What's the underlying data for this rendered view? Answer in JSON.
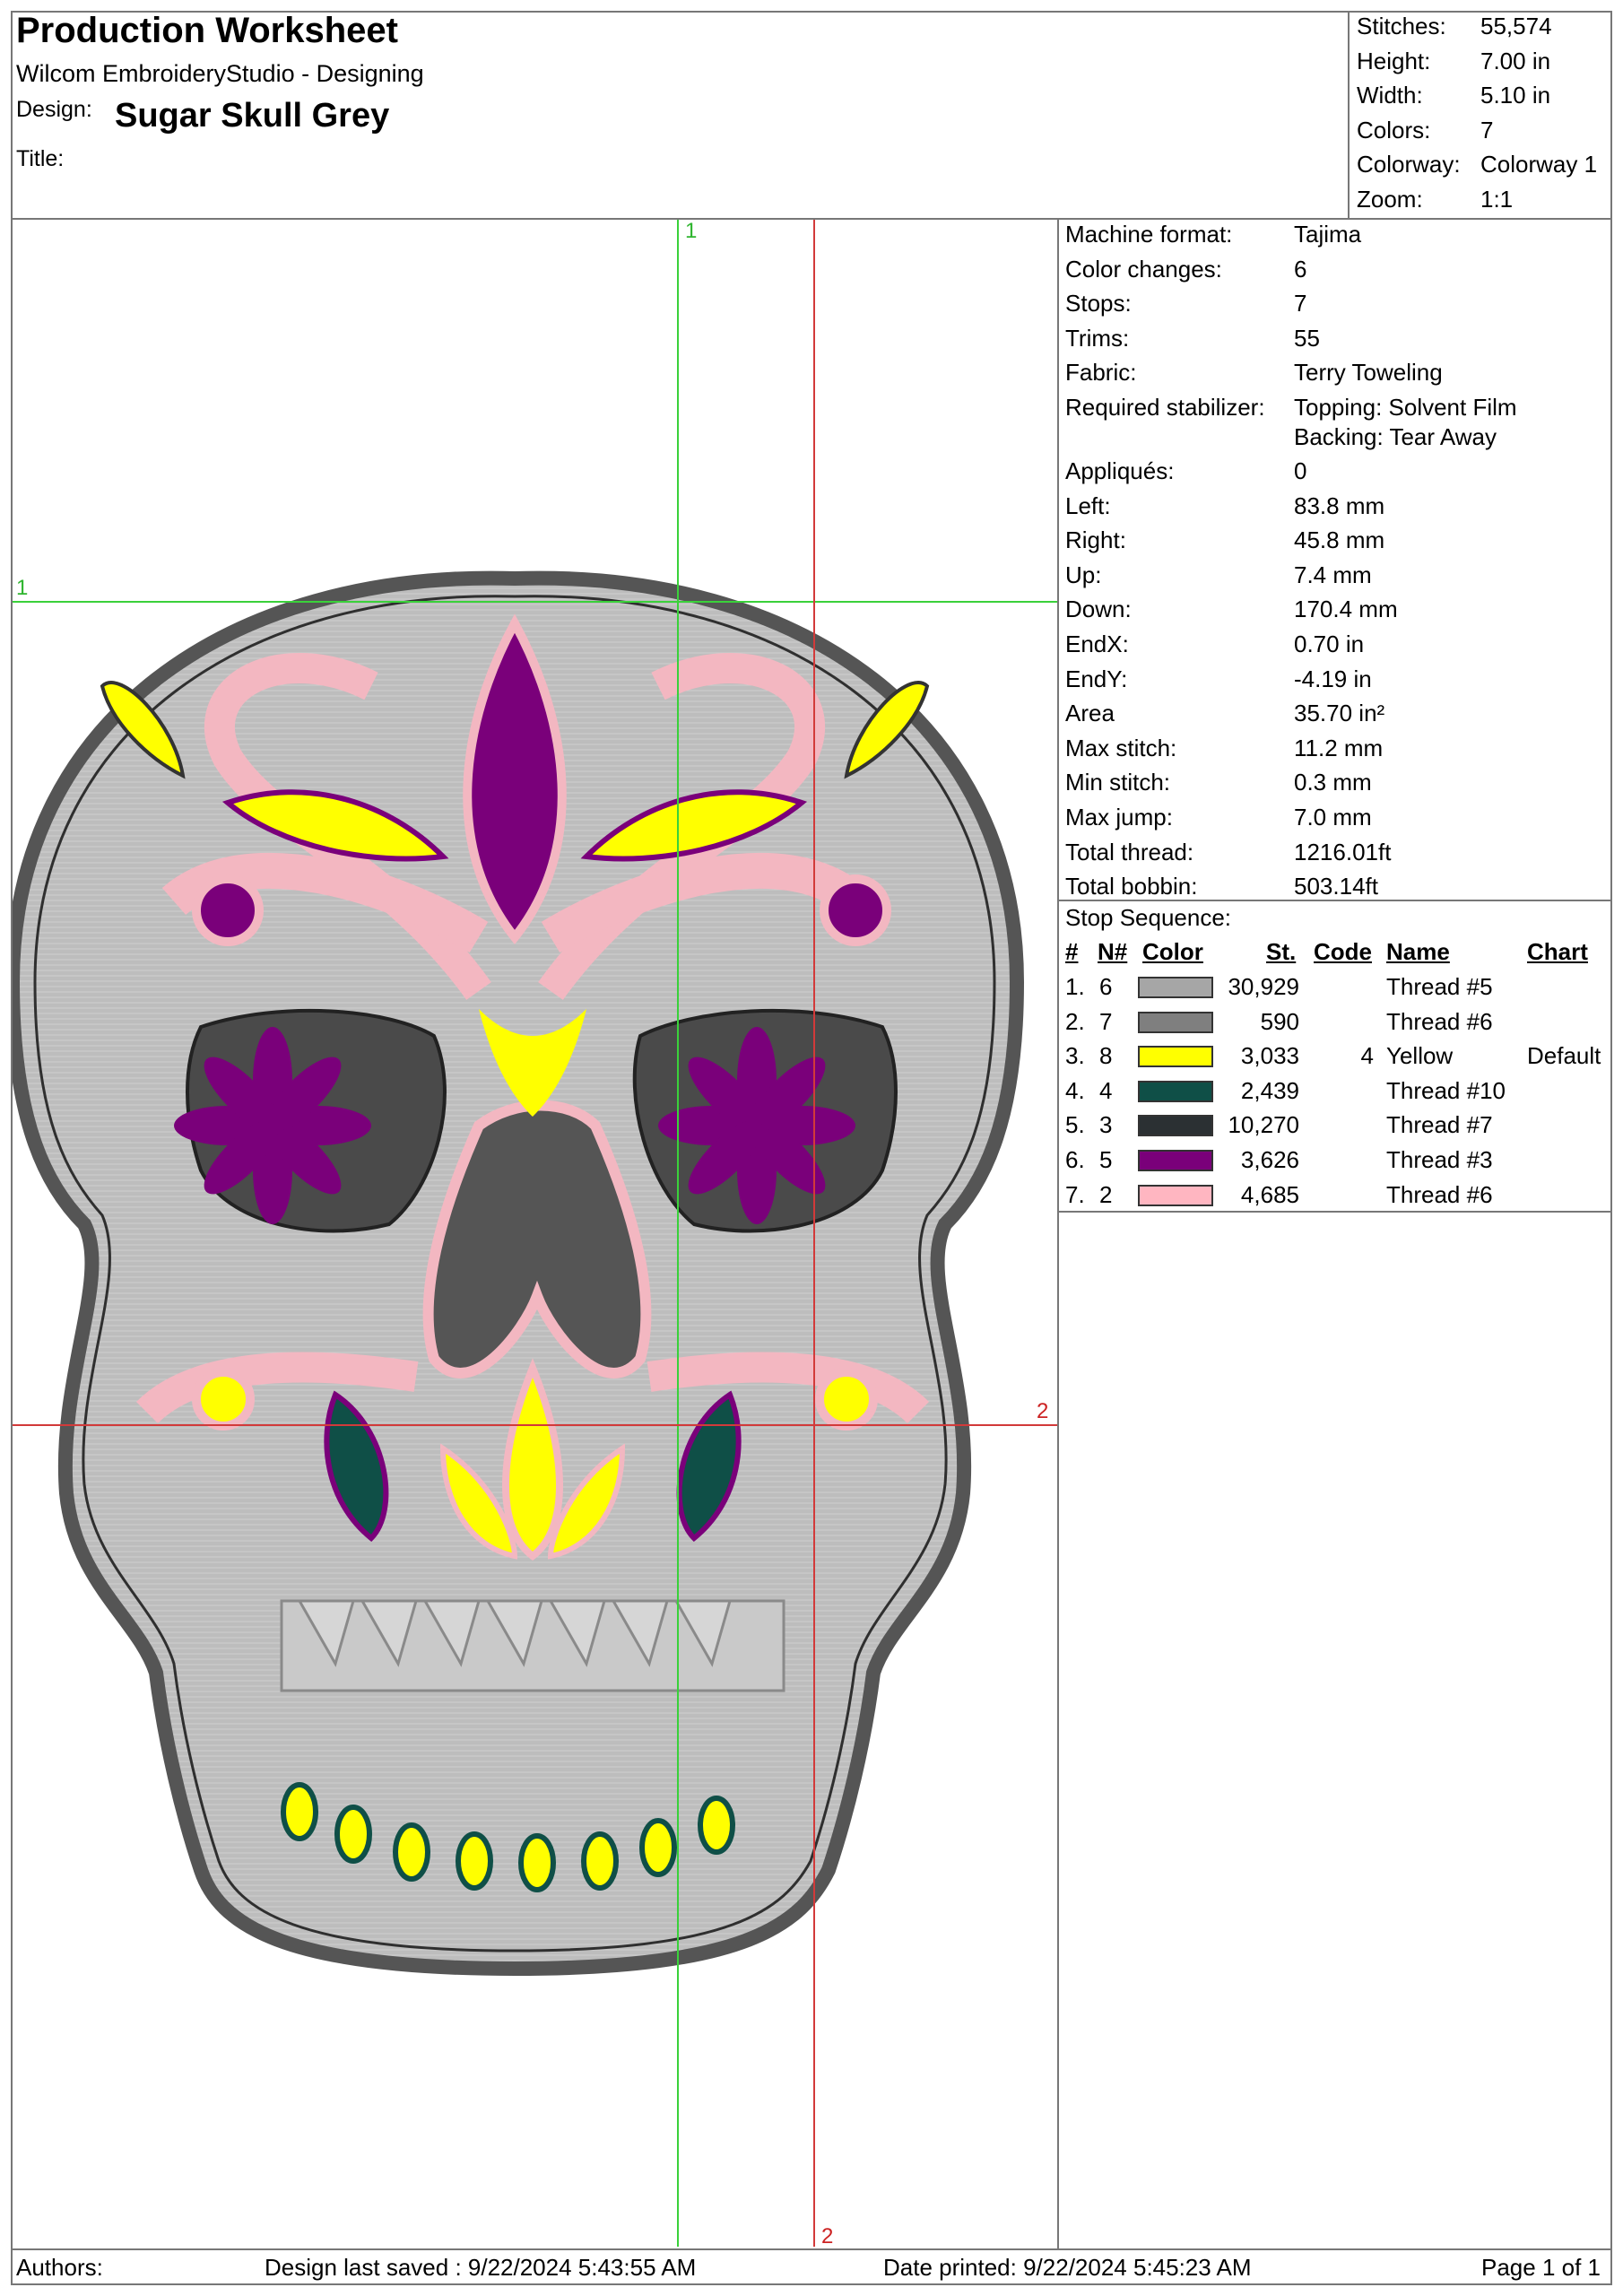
{
  "header": {
    "title": "Production Worksheet",
    "software": "Wilcom EmbroideryStudio - Designing",
    "design_label": "Design:",
    "design_name": "Sugar Skull Grey",
    "title_label": "Title:",
    "title_value": ""
  },
  "summary": [
    {
      "label": "Stitches:",
      "value": "55,574"
    },
    {
      "label": "Height:",
      "value": "7.00 in"
    },
    {
      "label": "Width:",
      "value": "5.10 in"
    },
    {
      "label": "Colors:",
      "value": "7"
    },
    {
      "label": "Colorway:",
      "value": "Colorway 1"
    },
    {
      "label": "Zoom:",
      "value": "1:1"
    }
  ],
  "details": [
    {
      "label": "Machine format:",
      "value": "Tajima"
    },
    {
      "label": "Color changes:",
      "value": "6"
    },
    {
      "label": "Stops:",
      "value": "7"
    },
    {
      "label": "Trims:",
      "value": "55"
    },
    {
      "label": "Fabric:",
      "value": "Terry Toweling"
    },
    {
      "label": "Required stabilizer:",
      "value": "Topping: Solvent Film",
      "value2": "Backing: Tear Away"
    },
    {
      "label": "Appliqués:",
      "value": "0"
    },
    {
      "label": "Left:",
      "value": "83.8 mm"
    },
    {
      "label": "Right:",
      "value": "45.8 mm"
    },
    {
      "label": "Up:",
      "value": "7.4 mm"
    },
    {
      "label": "Down:",
      "value": "170.4 mm"
    },
    {
      "label": "EndX:",
      "value": "0.70 in"
    },
    {
      "label": "EndY:",
      "value": "-4.19 in"
    },
    {
      "label": "Area",
      "value": " 35.70 in²"
    },
    {
      "label": "Max stitch:",
      "value": "11.2 mm"
    },
    {
      "label": "Min stitch:",
      "value": "0.3 mm"
    },
    {
      "label": "Max jump:",
      "value": "7.0 mm"
    },
    {
      "label": "Total thread:",
      "value": "1216.01ft"
    },
    {
      "label": "Total bobbin:",
      "value": "503.14ft"
    }
  ],
  "stop_sequence": {
    "title": "Stop Sequence:",
    "headers": {
      "idx": "#",
      "n": "N#",
      "color": "Color",
      "st": "St.",
      "code": "Code",
      "name": "Name",
      "chart": "Chart"
    },
    "rows": [
      {
        "idx": "1.",
        "n": "6",
        "color": "#a6a6a6",
        "st": "30,929",
        "code": "",
        "name": "Thread #5",
        "chart": ""
      },
      {
        "idx": "2.",
        "n": "7",
        "color": "#7f7f7f",
        "st": "590",
        "code": "",
        "name": "Thread #6",
        "chart": ""
      },
      {
        "idx": "3.",
        "n": "8",
        "color": "#ffff00",
        "st": "3,033",
        "code": "4",
        "name": "Yellow",
        "chart": "Default"
      },
      {
        "idx": "4.",
        "n": "4",
        "color": "#0f4f47",
        "st": "2,439",
        "code": "",
        "name": "Thread #10",
        "chart": ""
      },
      {
        "idx": "5.",
        "n": "3",
        "color": "#2b3033",
        "st": "10,270",
        "code": "",
        "name": "Thread #7",
        "chart": ""
      },
      {
        "idx": "6.",
        "n": "5",
        "color": "#7a007a",
        "st": "3,626",
        "code": "",
        "name": "Thread #3",
        "chart": ""
      },
      {
        "idx": "7.",
        "n": "2",
        "color": "#ffb6c1",
        "st": "4,685",
        "code": "",
        "name": "Thread #6",
        "chart": ""
      }
    ]
  },
  "guides": {
    "v1": "1",
    "h1": "1",
    "h2": "2",
    "v2": "2"
  },
  "footer": {
    "authors": "Authors:",
    "saved": "Design last saved : 9/22/2024 5:43:55 AM",
    "printed": "Date printed: 9/22/2024 5:45:23 AM",
    "page": "Page 1 of 1"
  }
}
